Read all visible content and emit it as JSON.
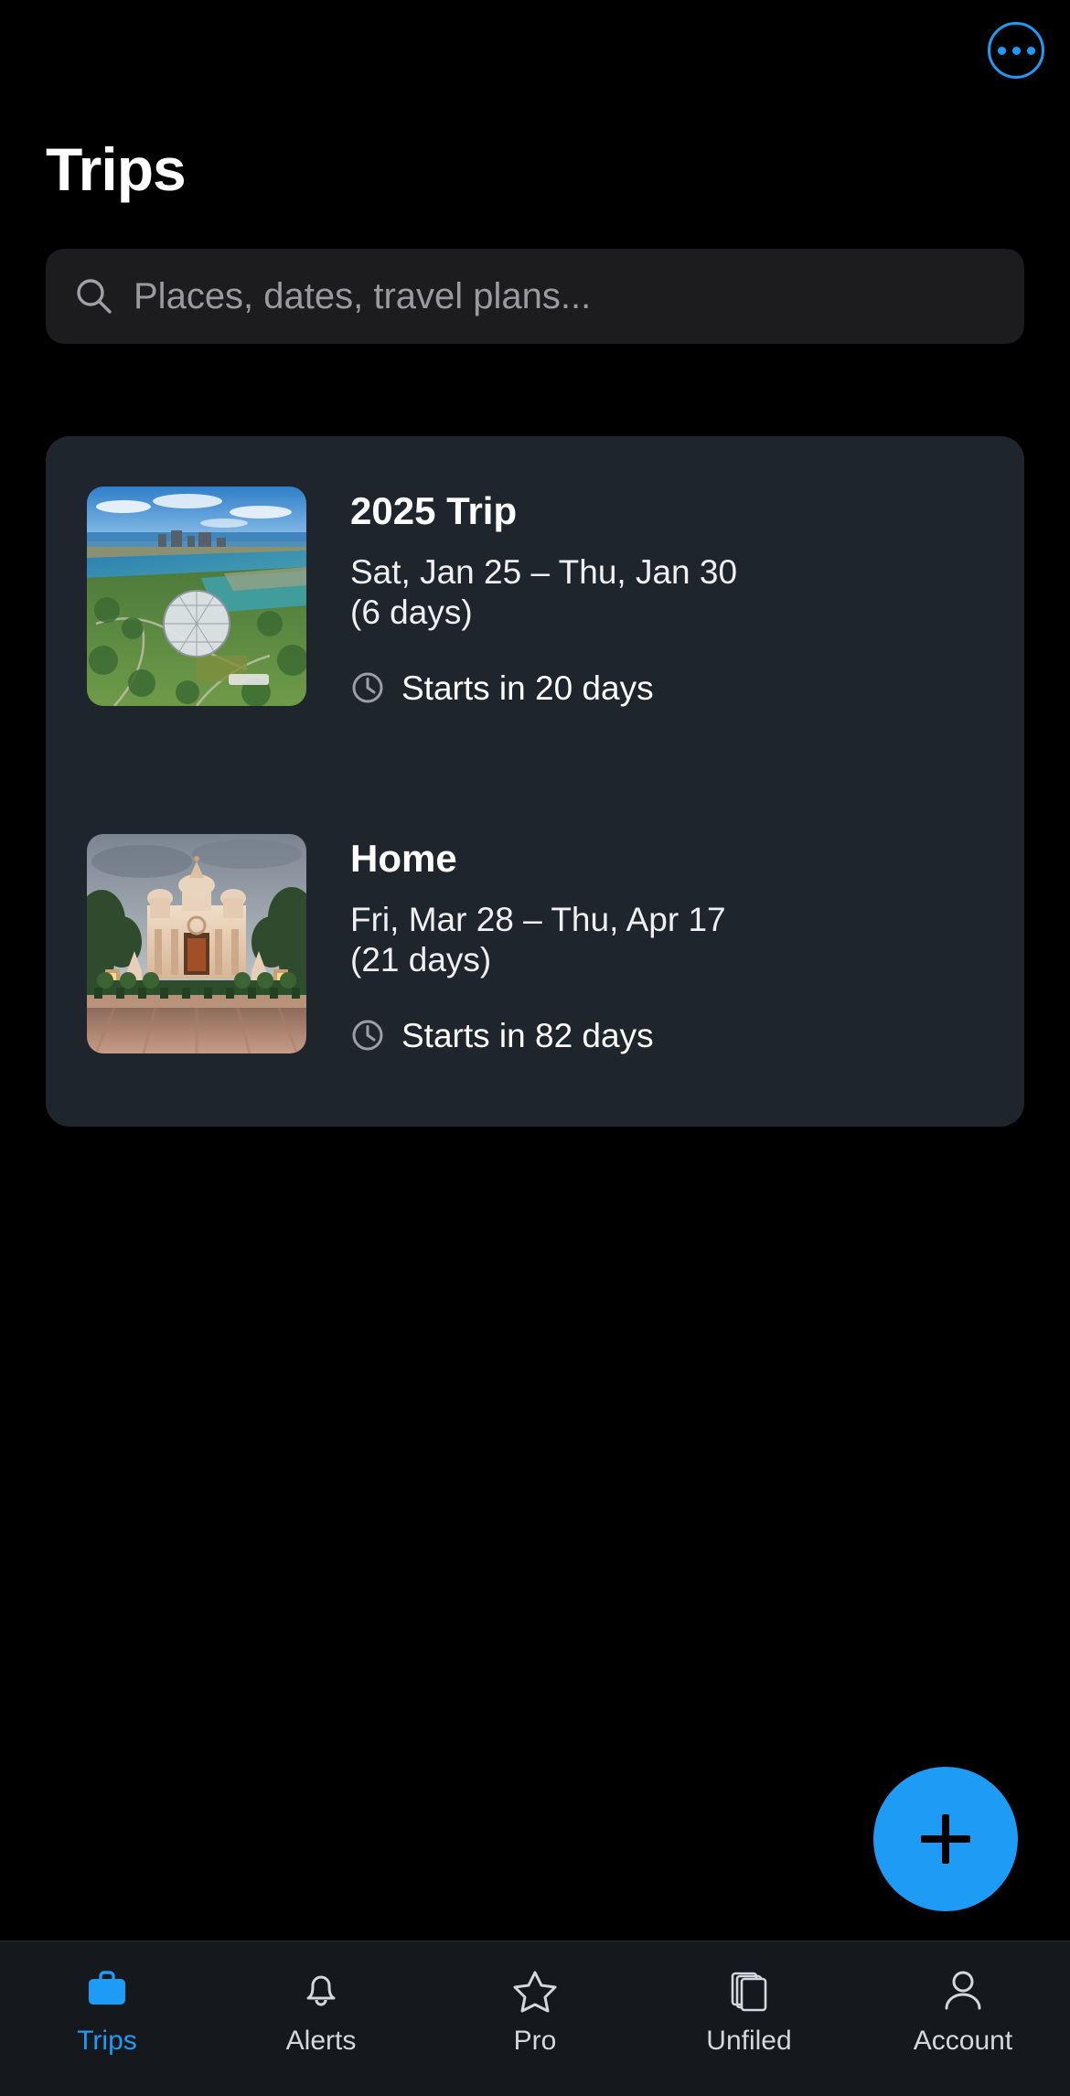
{
  "header": {
    "title": "Trips",
    "more_icon": "more-horizontal-icon",
    "accent_color": "#1e9bf5"
  },
  "search": {
    "icon": "search-icon",
    "placeholder": "Places, dates, travel plans...",
    "value": ""
  },
  "trips": [
    {
      "name": "2025 Trip",
      "dates": "Sat, Jan 25 – Thu, Jan 30\n(6 days)",
      "status_icon": "clock-icon",
      "status": "Starts in 20 days",
      "thumbnail": "aerial-river-park-biosphere-photo"
    },
    {
      "name": "Home",
      "dates": "Fri, Mar 28 – Thu, Apr 17\n(21 days)",
      "status_icon": "clock-icon",
      "status": "Starts in 82 days",
      "thumbnail": "temple-palm-trees-plaza-photo"
    }
  ],
  "fab": {
    "icon": "plus-icon",
    "label": "Add trip",
    "color": "#1e9bf5"
  },
  "tabbar": {
    "items": [
      {
        "label": "Trips",
        "icon": "briefcase-icon",
        "active": true
      },
      {
        "label": "Alerts",
        "icon": "bell-icon",
        "active": false
      },
      {
        "label": "Pro",
        "icon": "star-icon",
        "active": false
      },
      {
        "label": "Unfiled",
        "icon": "documents-icon",
        "active": false
      },
      {
        "label": "Account",
        "icon": "person-icon",
        "active": false
      }
    ]
  }
}
